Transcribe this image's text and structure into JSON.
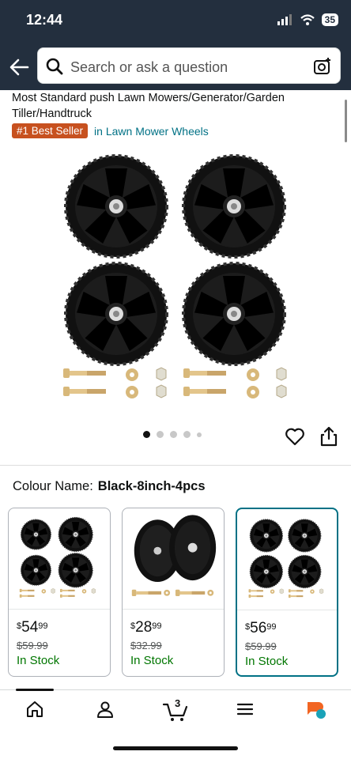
{
  "status": {
    "time": "12:44",
    "battery": "35"
  },
  "search": {
    "placeholder": "Search or ask a question"
  },
  "product": {
    "title": "Most Standard push Lawn Mowers/Generator/Garden Tiller/Handtruck",
    "badge": "#1 Best Seller",
    "category_link": "in Lawn Mower Wheels"
  },
  "gallery": {
    "dots": 5,
    "active_index": 0
  },
  "colour": {
    "label": "Colour Name:",
    "value": "Black-8inch-4pcs"
  },
  "variants": [
    {
      "currency": "$",
      "price_whole": "54",
      "price_cents": "99",
      "was": "$59.99",
      "stock": "In Stock",
      "selected": false
    },
    {
      "currency": "$",
      "price_whole": "28",
      "price_cents": "99",
      "was": "$32.99",
      "stock": "In Stock",
      "selected": false
    },
    {
      "currency": "$",
      "price_whole": "56",
      "price_cents": "99",
      "was": "$59.99",
      "stock": "In Stock",
      "selected": true
    }
  ],
  "nav": {
    "cart_count": "3",
    "items": [
      "home-icon",
      "account-icon",
      "cart-icon",
      "menu-icon",
      "rufus-icon"
    ]
  },
  "colors": {
    "header_bg": "#232f3e",
    "badge": "#c7511f",
    "link": "#007185",
    "in_stock": "#007600",
    "selected_border": "#007185"
  }
}
